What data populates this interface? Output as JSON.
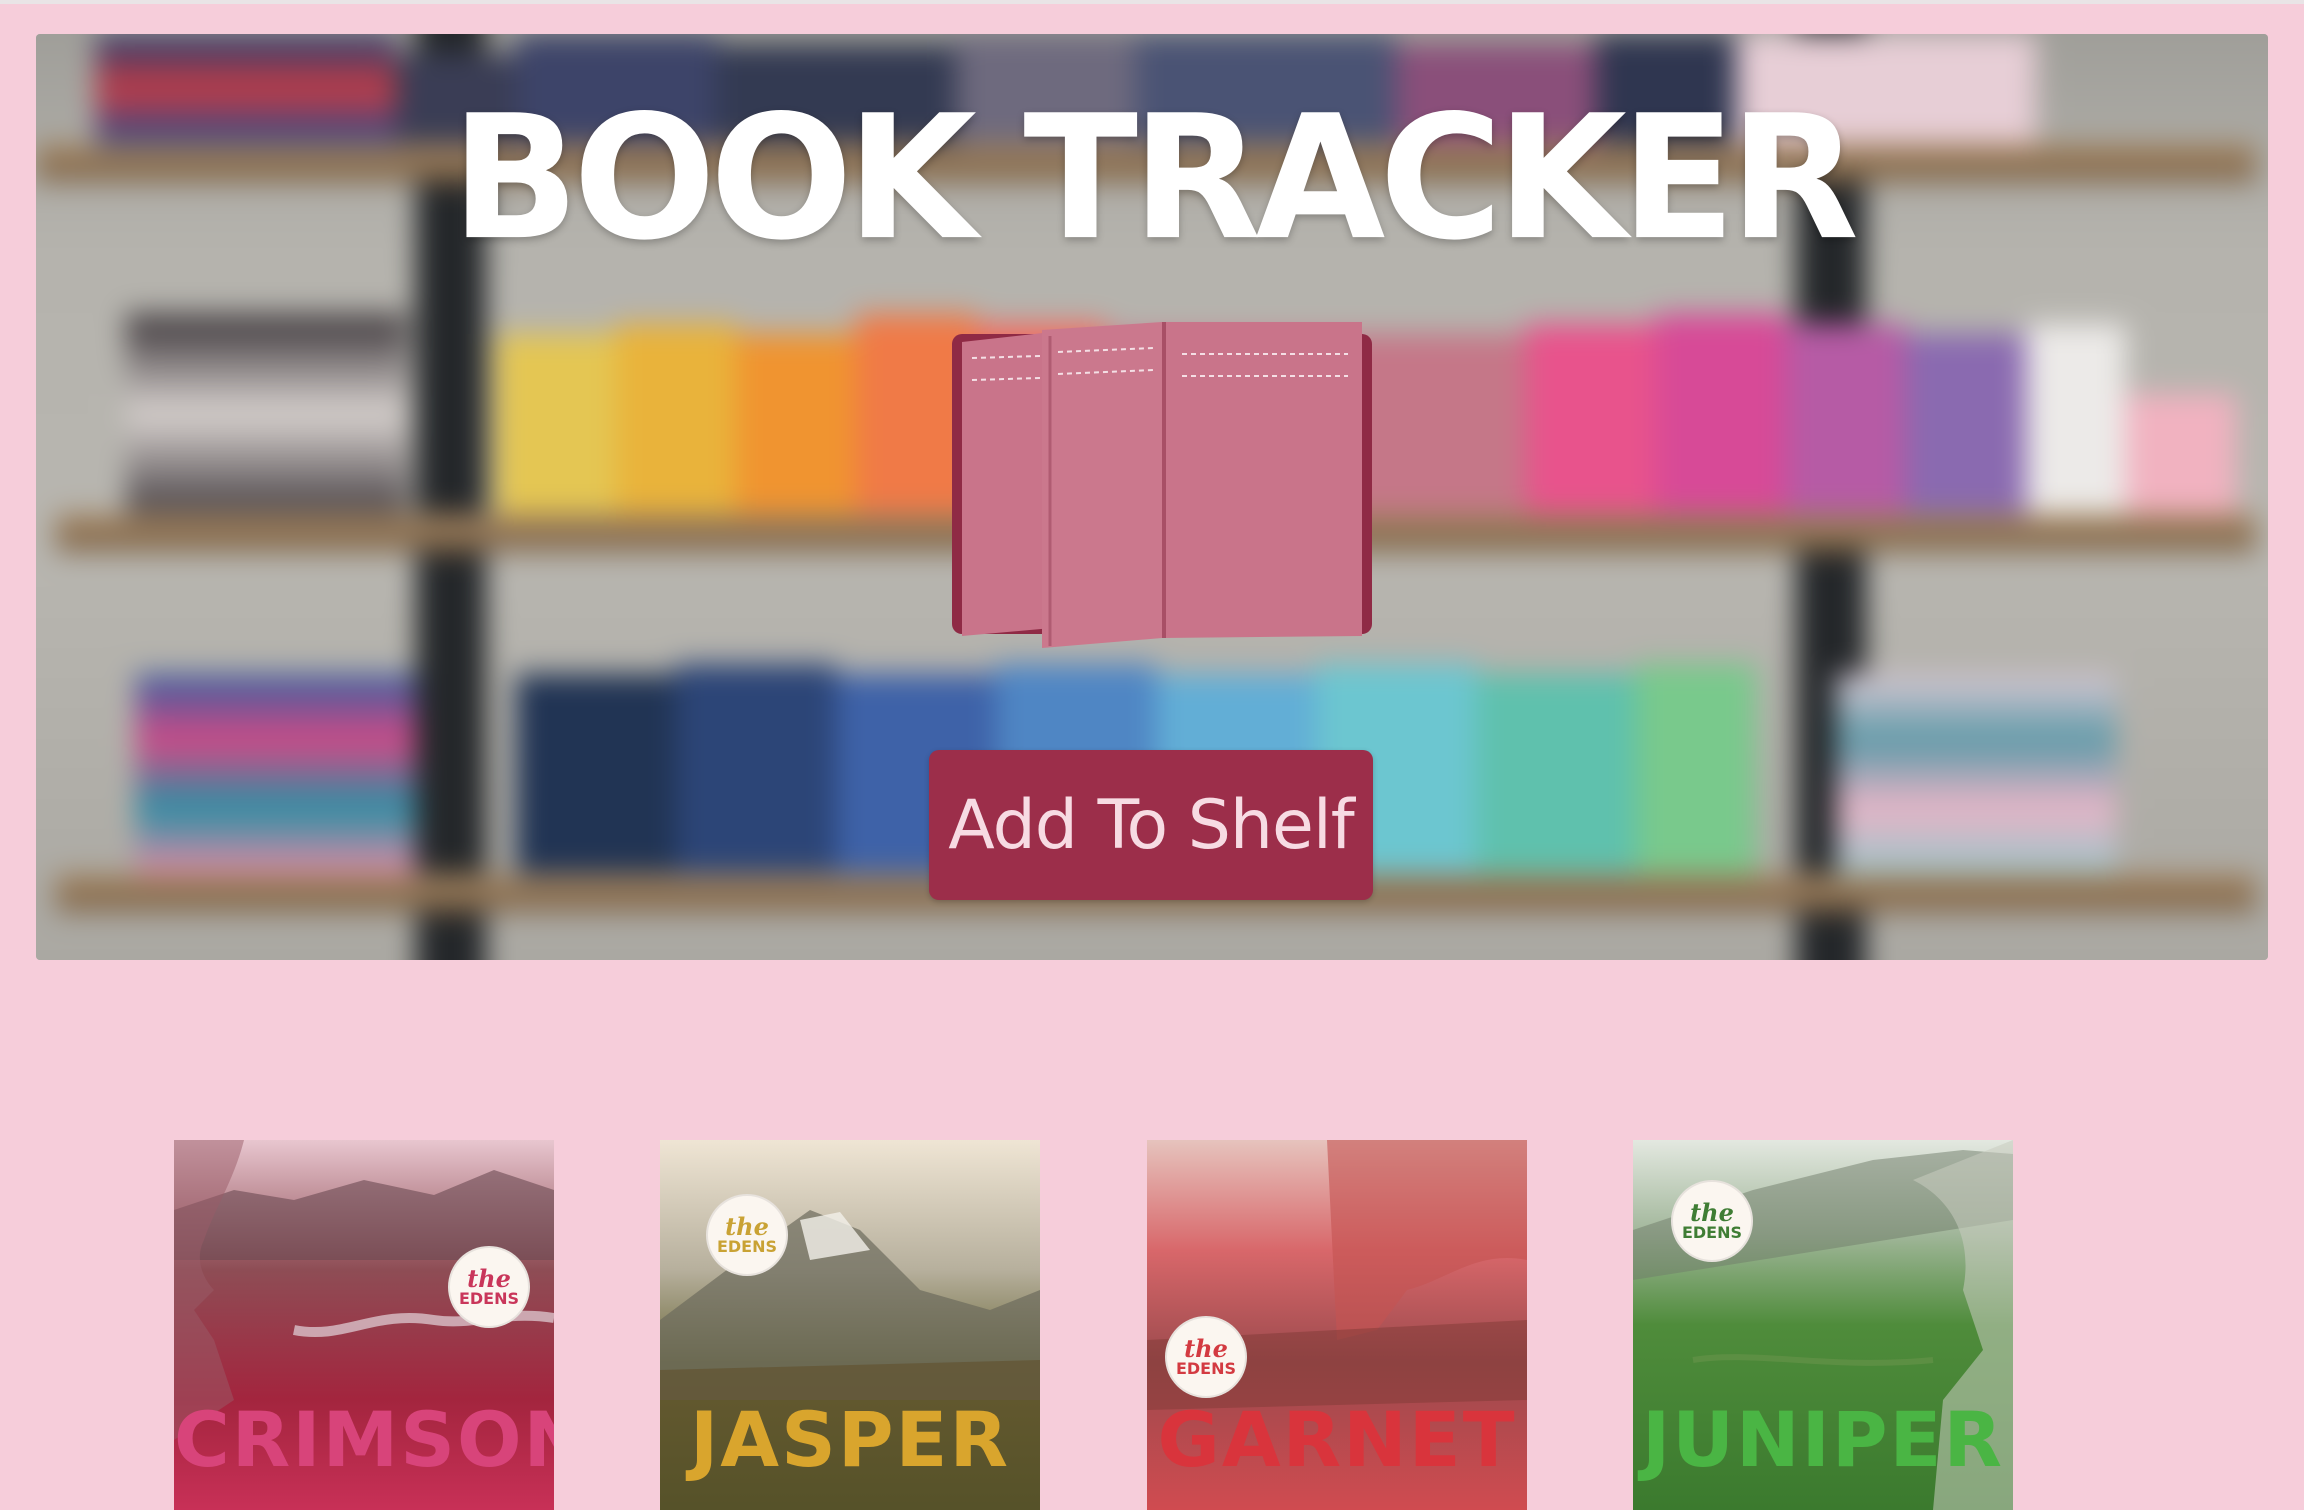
{
  "app": {
    "title": "BOOK TRACKER",
    "add_button_label": "Add To Shelf"
  },
  "colors": {
    "page_background": "#f6cdda",
    "button_background": "#9c2e4a",
    "button_text": "#f7dbe3",
    "book_icon": "#c9748a"
  },
  "books": [
    {
      "title": "CRIMSON",
      "series_badge_the": "the",
      "series_badge_name": "EDENS",
      "accent": "#c9365a"
    },
    {
      "title": "JASPER",
      "series_badge_the": "the",
      "series_badge_name": "EDENS",
      "accent": "#d6a630"
    },
    {
      "title": "GARNET",
      "series_badge_the": "the",
      "series_badge_name": "EDENS",
      "accent": "#d8393f"
    },
    {
      "title": "JUNIPER",
      "series_badge_the": "the",
      "series_badge_name": "EDENS",
      "accent": "#3f8f34"
    }
  ]
}
